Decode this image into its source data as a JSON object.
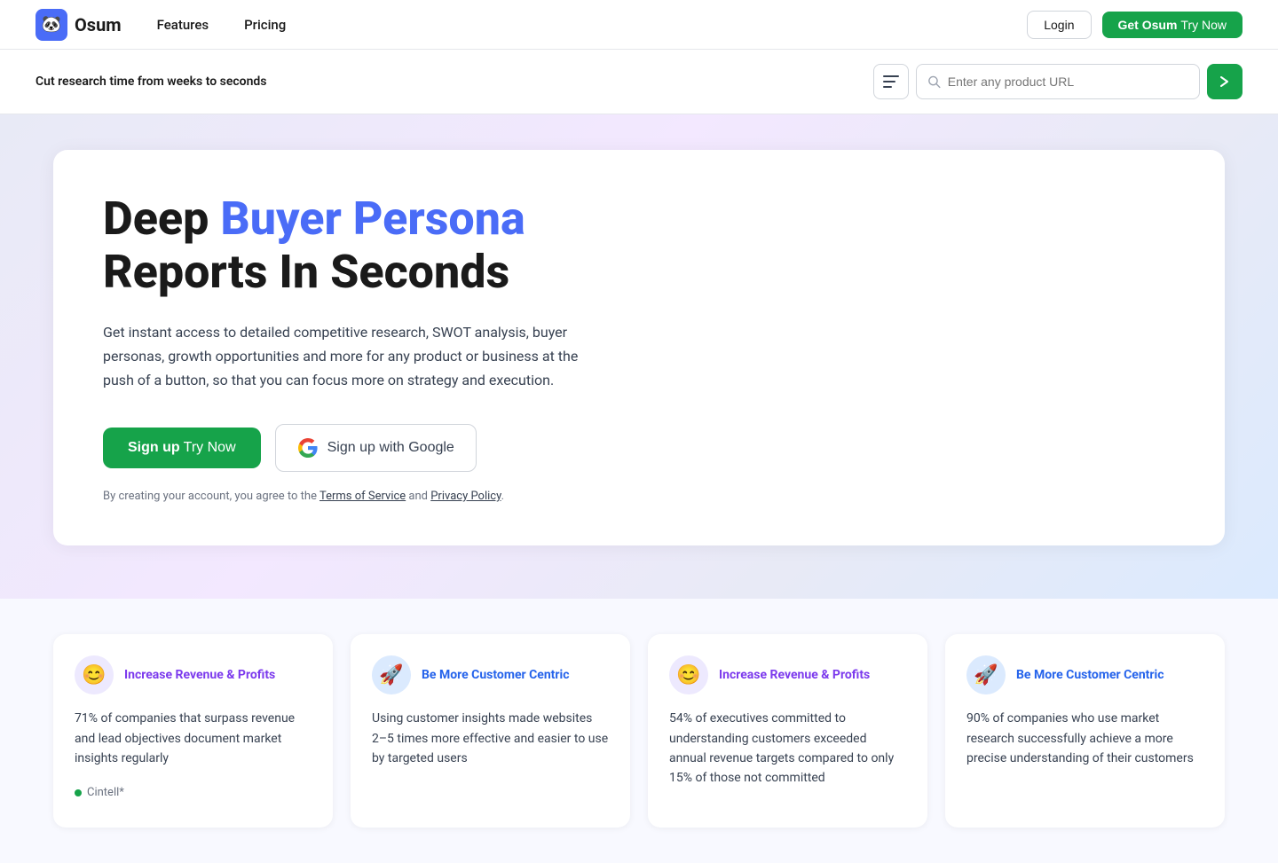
{
  "nav": {
    "logo_text": "Osum",
    "logo_icon": "🐼",
    "features_label": "Features",
    "pricing_label": "Pricing",
    "login_label": "Login",
    "get_osum_label": "Get Osum",
    "try_now_label": "Try Now"
  },
  "subheader": {
    "text": "Cut research time from weeks to seconds",
    "search_placeholder": "Enter any product URL",
    "go_arrow": "❯"
  },
  "hero": {
    "title_black1": "Deep ",
    "title_blue": "Buyer Persona",
    "title_black2": " Reports In Seconds",
    "subtitle": "Get instant access to detailed competitive research, SWOT analysis, buyer personas, growth opportunities and more for any product or business at the push of a button, so that you can focus more on strategy and execution.",
    "signup_label": "Sign up",
    "try_now_label": " Try Now",
    "google_label": "Sign up with Google",
    "disclaimer_prefix": "By creating your account, you agree to the ",
    "tos_label": "Terms of Service",
    "and_text": " and ",
    "privacy_label": "Privacy Policy",
    "disclaimer_suffix": "."
  },
  "cards": [
    {
      "id": "card1",
      "icon": "😊",
      "icon_style": "purple",
      "title": "Increase Revenue & Profits",
      "title_style": "purple",
      "body": "71% of companies that surpass revenue and lead objectives document market insights regularly",
      "source": "Cintell*"
    },
    {
      "id": "card2",
      "icon": "🚀",
      "icon_style": "blue",
      "title": "Be More Customer Centric",
      "title_style": "blue",
      "body": "Using customer insights made websites 2–5 times more effective and easier to use by targeted users",
      "source": ""
    },
    {
      "id": "card3",
      "icon": "😊",
      "icon_style": "purple",
      "title": "Increase Revenue & Profits",
      "title_style": "purple",
      "body": "54% of executives committed to understanding customers exceeded annual revenue targets compared to only 15% of those not committed",
      "source": ""
    },
    {
      "id": "card4",
      "icon": "🚀",
      "icon_style": "blue",
      "title": "Be More Customer Centric",
      "title_style": "blue",
      "body": "90% of companies who use market research successfully achieve a more precise understanding of their customers",
      "source": ""
    }
  ]
}
